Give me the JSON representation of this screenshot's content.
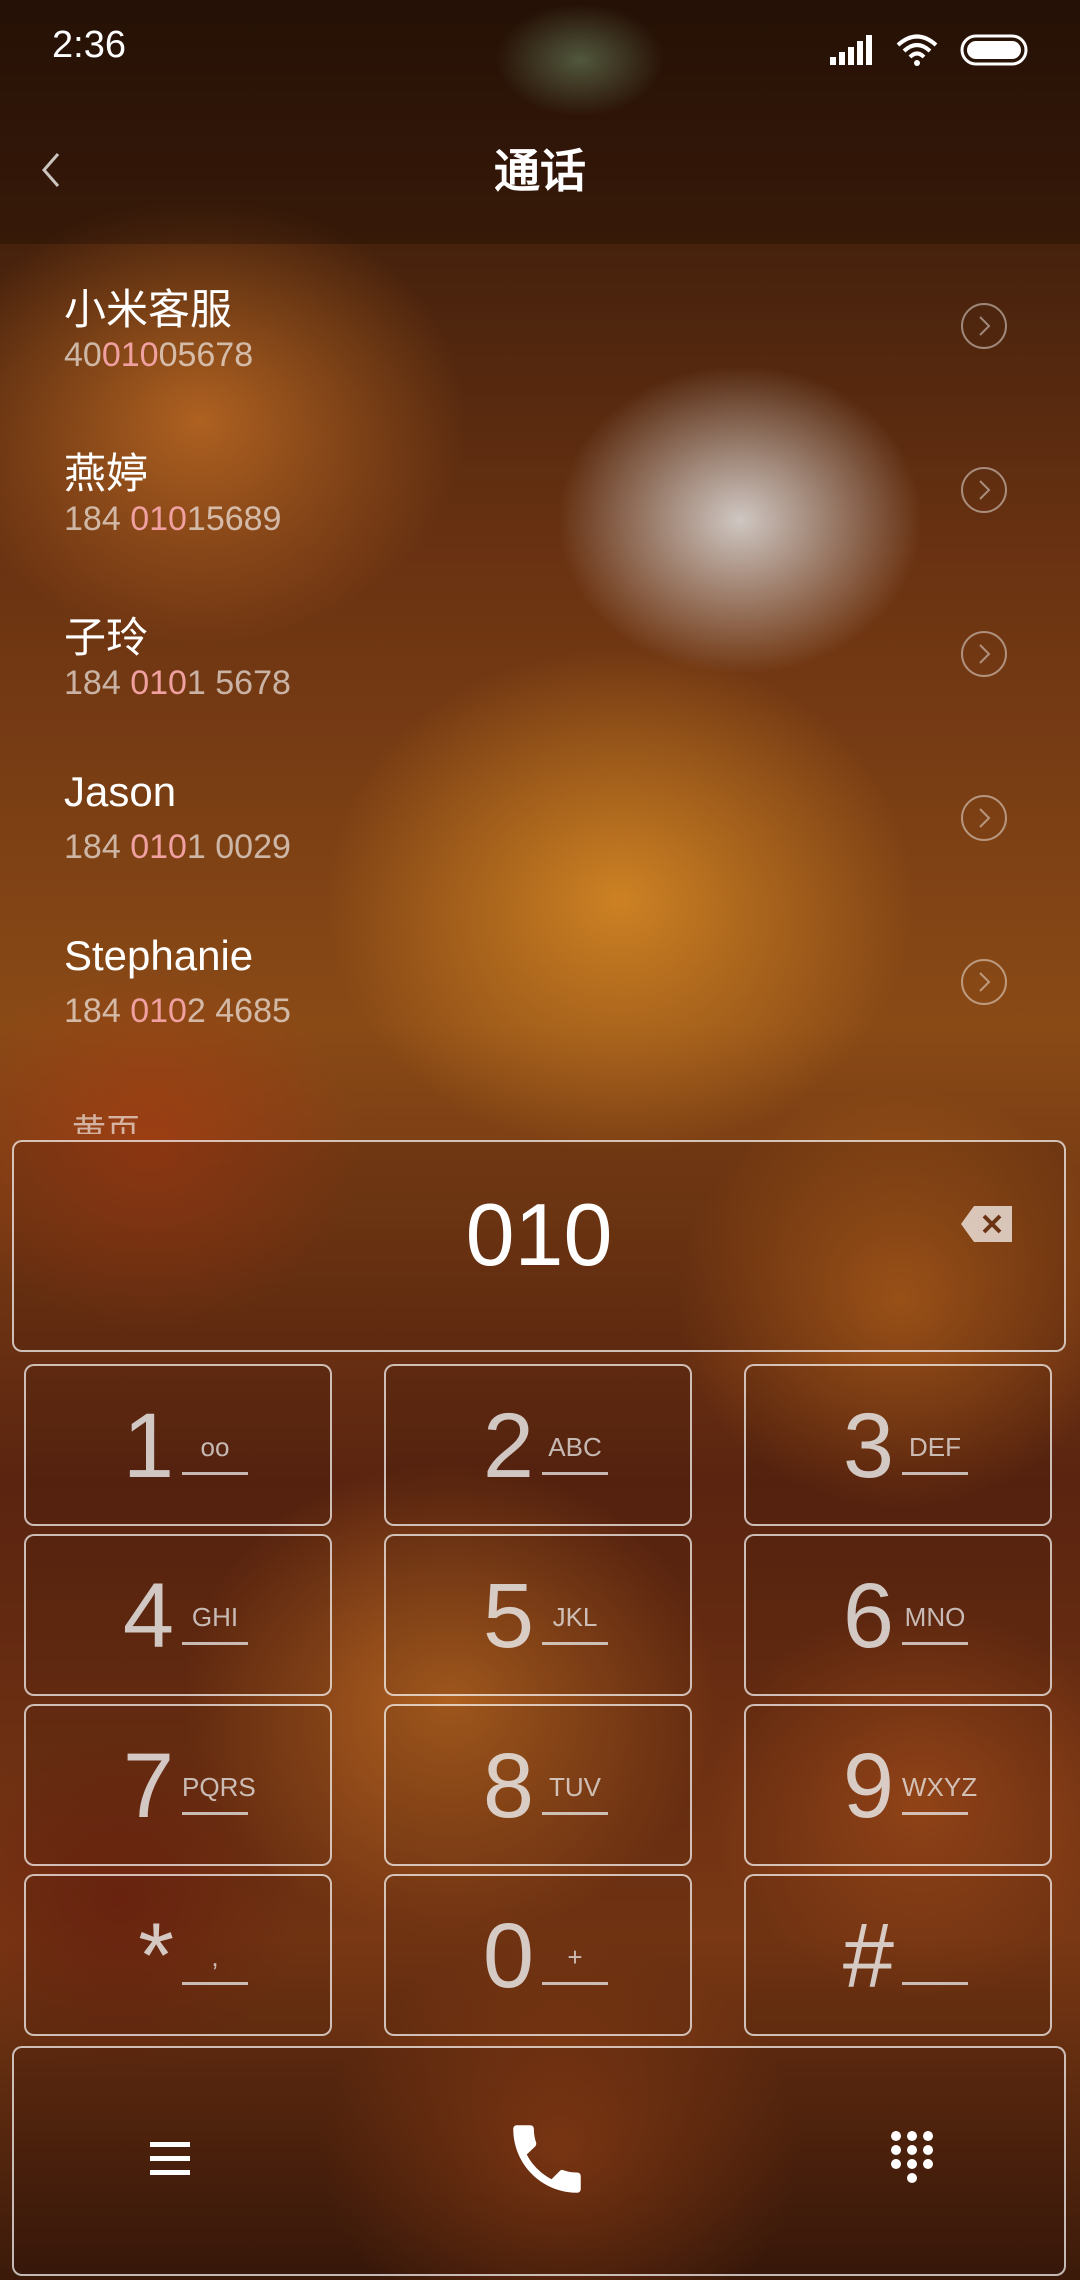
{
  "status_bar": {
    "time": "2:36",
    "icons": [
      "signal-icon",
      "wifi-icon",
      "battery-icon"
    ]
  },
  "header": {
    "title": "通话",
    "back_icon": "chevron-left-icon"
  },
  "contacts": [
    {
      "name": "小米客服",
      "number_parts": [
        "4001",
        "005678"
      ],
      "highlight": "010"
    },
    {
      "name": "燕婷",
      "number_parts": [
        "184 ",
        "01015689"
      ],
      "highlight": "010"
    },
    {
      "name": "子玲",
      "number_parts": [
        "184 ",
        "0101 5678"
      ],
      "highlight": "010"
    },
    {
      "name": "Jason",
      "number_parts": [
        "184 ",
        "0101 0029"
      ],
      "highlight": "010"
    },
    {
      "name": "Stephanie",
      "number_parts": [
        "184 ",
        "0102 4685"
      ],
      "highlight": "010"
    }
  ],
  "partial_entry": "黄页",
  "dialer": {
    "dialed_number": "010",
    "backspace_icon": "backspace-icon"
  },
  "keypad": [
    {
      "digit": "1",
      "letters": "oo"
    },
    {
      "digit": "2",
      "letters": "ABC"
    },
    {
      "digit": "3",
      "letters": "DEF"
    },
    {
      "digit": "4",
      "letters": "GHI"
    },
    {
      "digit": "5",
      "letters": "JKL"
    },
    {
      "digit": "6",
      "letters": "MNO"
    },
    {
      "digit": "7",
      "letters": "PQRS"
    },
    {
      "digit": "8",
      "letters": "TUV"
    },
    {
      "digit": "9",
      "letters": "WXYZ"
    },
    {
      "digit": "*",
      "letters": ","
    },
    {
      "digit": "0",
      "letters": "+"
    },
    {
      "digit": "#",
      "letters": ""
    }
  ],
  "bottom_bar": {
    "menu_icon": "menu-icon",
    "call_icon": "phone-icon",
    "keypad_icon": "dialpad-icon"
  },
  "colors": {
    "text": "#ffffff",
    "highlight": "#f0a0a0"
  }
}
